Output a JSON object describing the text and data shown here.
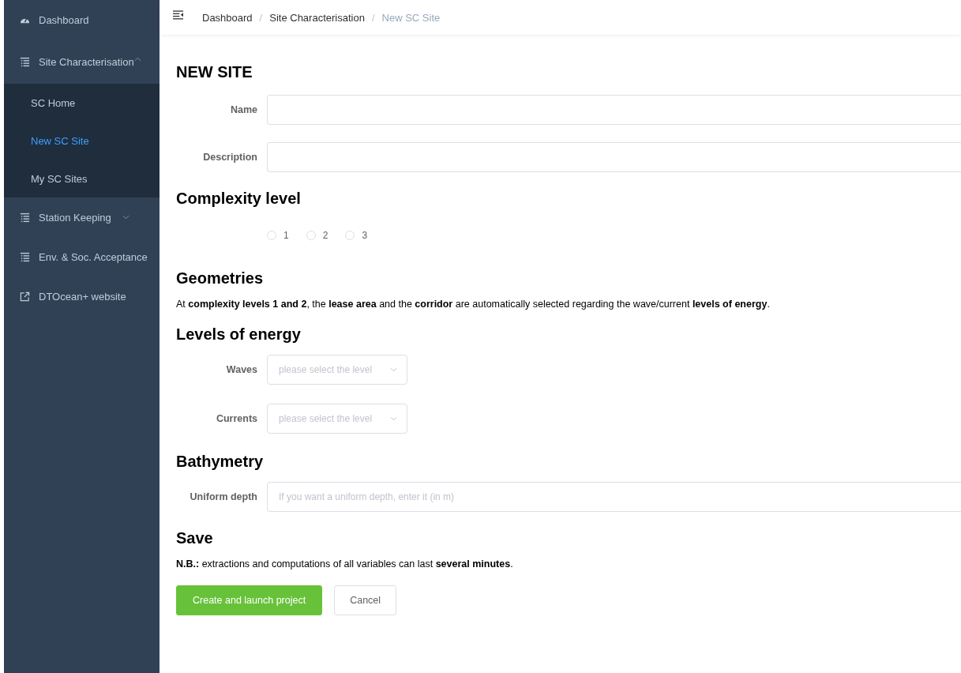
{
  "sidebar": {
    "items": [
      {
        "kind": "dashboard",
        "label": "Dashboard"
      },
      {
        "kind": "menu",
        "label": "Site Characterisation",
        "expanded": true,
        "children": [
          {
            "label": "SC Home",
            "selected": false
          },
          {
            "label": "New SC Site",
            "selected": true
          },
          {
            "label": "My SC Sites",
            "selected": false
          }
        ]
      },
      {
        "kind": "menu",
        "label": "Station Keeping",
        "expanded": false
      },
      {
        "kind": "entry",
        "label": "Env. & Soc. Acceptance"
      },
      {
        "kind": "external",
        "label": "DTOcean+ website"
      }
    ]
  },
  "breadcrumb": [
    {
      "label": "Dashboard"
    },
    {
      "separator": "/",
      "label": "Site Characterisation"
    },
    {
      "separator": "/",
      "label": "New SC Site"
    }
  ],
  "title": "NEW SITE",
  "fields": [
    {
      "label": "Name"
    },
    {
      "label": "Description"
    }
  ],
  "complexity": {
    "heading": "Complexity level",
    "options": [
      {
        "label": "1",
        "selected": false
      },
      {
        "label": "2",
        "selected": false
      },
      {
        "label": "3",
        "selected": false
      }
    ]
  },
  "geometries": {
    "heading": "Geometries",
    "text": "At **complexity levels 1 and 2**, the **lease area** and the **corridor** are automatically selected regarding the wave/current **levels of energy**."
  },
  "energy": {
    "heading": "Levels of energy",
    "selects": [
      {
        "label": "Waves",
        "placeholder": "please select the level"
      },
      {
        "label": "Currents",
        "placeholder": "please select the level"
      }
    ]
  },
  "bathymetry": {
    "heading": "Bathymetry",
    "label": "Uniform depth",
    "placeholder": "If you want a uniform depth, enter it (in m)"
  },
  "save": {
    "heading": "Save",
    "note": "**N.B.:** extractions and computations of all variables can last **several minutes**.",
    "primary": "Create and launch project",
    "cancel": "Cancel"
  }
}
